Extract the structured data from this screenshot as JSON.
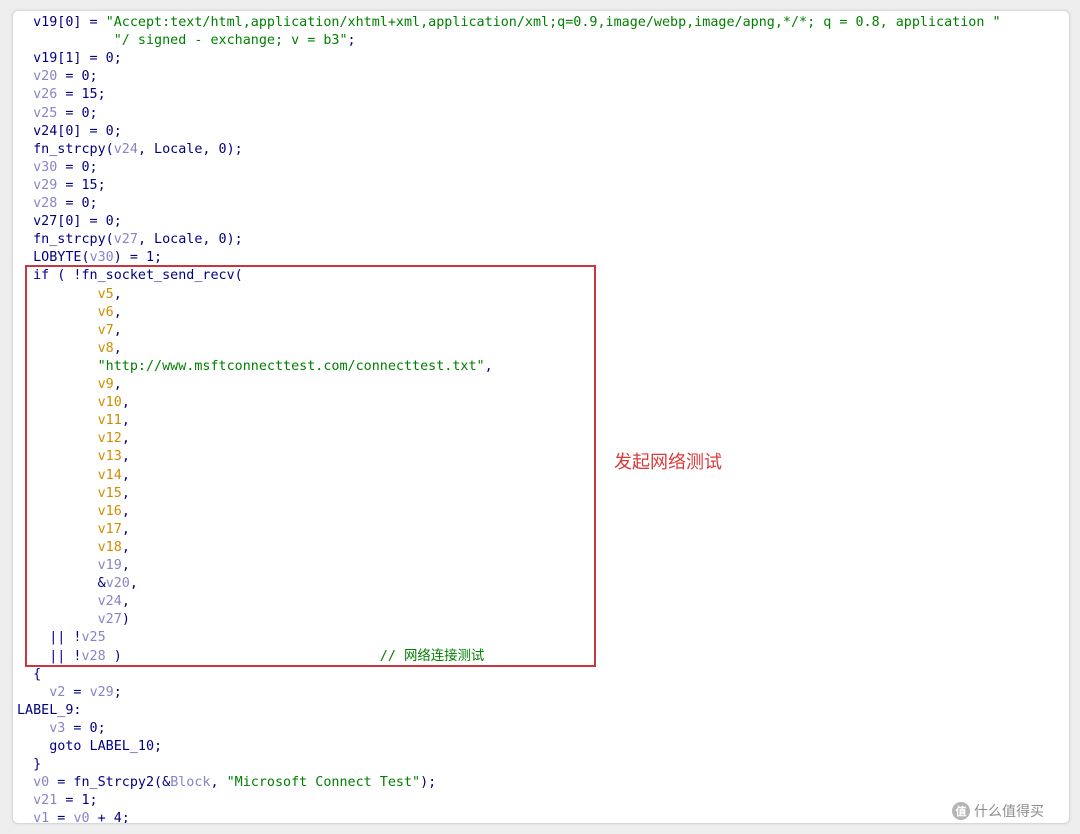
{
  "annotation": "发起网络测试",
  "watermark": {
    "icon": "值",
    "text": "什么值得买"
  },
  "code_lines": [
    {
      "indent": "  ",
      "segments": [
        {
          "t": "v19[0] = ",
          "c": "tok-kw"
        },
        {
          "t": "\"Accept:text/html,application/xhtml+xml,application/xml;q=0.9,image/webp,image/apng,*/*; q = 0.8, application \"",
          "c": "tok-str"
        }
      ]
    },
    {
      "indent": "            ",
      "segments": [
        {
          "t": "\"/ signed - exchange; v = b3\"",
          "c": "tok-str"
        },
        {
          "t": ";",
          "c": "tok-kw"
        }
      ]
    },
    {
      "indent": "  ",
      "segments": [
        {
          "t": "v19[1] = 0;",
          "c": "tok-kw"
        }
      ]
    },
    {
      "indent": "  ",
      "segments": [
        {
          "t": "v20",
          "c": "tok-var"
        },
        {
          "t": " = 0;",
          "c": "tok-kw"
        }
      ]
    },
    {
      "indent": "  ",
      "segments": [
        {
          "t": "v26",
          "c": "tok-var"
        },
        {
          "t": " = 15;",
          "c": "tok-kw"
        }
      ]
    },
    {
      "indent": "  ",
      "segments": [
        {
          "t": "v25",
          "c": "tok-var"
        },
        {
          "t": " = 0;",
          "c": "tok-kw"
        }
      ]
    },
    {
      "indent": "  ",
      "segments": [
        {
          "t": "v24[0] = 0;",
          "c": "tok-kw"
        }
      ]
    },
    {
      "indent": "  ",
      "segments": [
        {
          "t": "fn_strcpy(",
          "c": "tok-fn"
        },
        {
          "t": "v24",
          "c": "tok-var"
        },
        {
          "t": ", Locale, 0);",
          "c": "tok-kw"
        }
      ]
    },
    {
      "indent": "  ",
      "segments": [
        {
          "t": "v30",
          "c": "tok-var"
        },
        {
          "t": " = 0;",
          "c": "tok-kw"
        }
      ]
    },
    {
      "indent": "  ",
      "segments": [
        {
          "t": "v29",
          "c": "tok-var"
        },
        {
          "t": " = 15;",
          "c": "tok-kw"
        }
      ]
    },
    {
      "indent": "  ",
      "segments": [
        {
          "t": "v28",
          "c": "tok-var"
        },
        {
          "t": " = 0;",
          "c": "tok-kw"
        }
      ]
    },
    {
      "indent": "  ",
      "segments": [
        {
          "t": "v27[0] = 0;",
          "c": "tok-kw"
        }
      ]
    },
    {
      "indent": "  ",
      "segments": [
        {
          "t": "fn_strcpy(",
          "c": "tok-fn"
        },
        {
          "t": "v27",
          "c": "tok-var"
        },
        {
          "t": ", Locale, 0);",
          "c": "tok-kw"
        }
      ]
    },
    {
      "indent": "  ",
      "segments": [
        {
          "t": "LOBYTE(",
          "c": "tok-kw"
        },
        {
          "t": "v30",
          "c": "tok-var"
        },
        {
          "t": ") = 1;",
          "c": "tok-kw"
        }
      ]
    },
    {
      "indent": "  ",
      "segments": [
        {
          "t": "if ( !fn_socket_send_recv(",
          "c": "tok-kw"
        }
      ]
    },
    {
      "indent": "          ",
      "segments": [
        {
          "t": "v5",
          "c": "tok-arg"
        },
        {
          "t": ",",
          "c": "tok-kw"
        }
      ]
    },
    {
      "indent": "          ",
      "segments": [
        {
          "t": "v6",
          "c": "tok-arg"
        },
        {
          "t": ",",
          "c": "tok-kw"
        }
      ]
    },
    {
      "indent": "          ",
      "segments": [
        {
          "t": "v7",
          "c": "tok-arg"
        },
        {
          "t": ",",
          "c": "tok-kw"
        }
      ]
    },
    {
      "indent": "          ",
      "segments": [
        {
          "t": "v8",
          "c": "tok-arg"
        },
        {
          "t": ",",
          "c": "tok-kw"
        }
      ]
    },
    {
      "indent": "          ",
      "segments": [
        {
          "t": "\"http://www.msftconnecttest.com/connecttest.txt\"",
          "c": "tok-str"
        },
        {
          "t": ",",
          "c": "tok-kw"
        }
      ]
    },
    {
      "indent": "          ",
      "segments": [
        {
          "t": "v9",
          "c": "tok-arg"
        },
        {
          "t": ",",
          "c": "tok-kw"
        }
      ]
    },
    {
      "indent": "          ",
      "segments": [
        {
          "t": "v10",
          "c": "tok-arg"
        },
        {
          "t": ",",
          "c": "tok-kw"
        }
      ]
    },
    {
      "indent": "          ",
      "segments": [
        {
          "t": "v11",
          "c": "tok-arg"
        },
        {
          "t": ",",
          "c": "tok-kw"
        }
      ]
    },
    {
      "indent": "          ",
      "segments": [
        {
          "t": "v12",
          "c": "tok-arg"
        },
        {
          "t": ",",
          "c": "tok-kw"
        }
      ]
    },
    {
      "indent": "          ",
      "segments": [
        {
          "t": "v13",
          "c": "tok-arg"
        },
        {
          "t": ",",
          "c": "tok-kw"
        }
      ]
    },
    {
      "indent": "          ",
      "segments": [
        {
          "t": "v14",
          "c": "tok-arg"
        },
        {
          "t": ",",
          "c": "tok-kw"
        }
      ]
    },
    {
      "indent": "          ",
      "segments": [
        {
          "t": "v15",
          "c": "tok-arg"
        },
        {
          "t": ",",
          "c": "tok-kw"
        }
      ]
    },
    {
      "indent": "          ",
      "segments": [
        {
          "t": "v16",
          "c": "tok-arg"
        },
        {
          "t": ",",
          "c": "tok-kw"
        }
      ]
    },
    {
      "indent": "          ",
      "segments": [
        {
          "t": "v17",
          "c": "tok-arg"
        },
        {
          "t": ",",
          "c": "tok-kw"
        }
      ]
    },
    {
      "indent": "          ",
      "segments": [
        {
          "t": "v18",
          "c": "tok-arg"
        },
        {
          "t": ",",
          "c": "tok-kw"
        }
      ]
    },
    {
      "indent": "          ",
      "segments": [
        {
          "t": "v19",
          "c": "tok-var"
        },
        {
          "t": ",",
          "c": "tok-kw"
        }
      ]
    },
    {
      "indent": "          ",
      "segments": [
        {
          "t": "&",
          "c": "tok-kw"
        },
        {
          "t": "v20",
          "c": "tok-var"
        },
        {
          "t": ",",
          "c": "tok-kw"
        }
      ]
    },
    {
      "indent": "          ",
      "segments": [
        {
          "t": "v24",
          "c": "tok-var"
        },
        {
          "t": ",",
          "c": "tok-kw"
        }
      ]
    },
    {
      "indent": "          ",
      "segments": [
        {
          "t": "v27",
          "c": "tok-var"
        },
        {
          "t": ")",
          "c": "tok-kw"
        }
      ]
    },
    {
      "indent": "    ",
      "segments": [
        {
          "t": "|| !",
          "c": "tok-kw"
        },
        {
          "t": "v25",
          "c": "tok-var"
        }
      ]
    },
    {
      "indent": "    ",
      "segments": [
        {
          "t": "|| !",
          "c": "tok-kw"
        },
        {
          "t": "v28",
          "c": "tok-var"
        },
        {
          "t": " )                                ",
          "c": "tok-kw"
        },
        {
          "t": "// 网络连接测试",
          "c": "tok-comment"
        }
      ]
    },
    {
      "indent": "  ",
      "segments": [
        {
          "t": "{",
          "c": "tok-kw"
        }
      ]
    },
    {
      "indent": "    ",
      "segments": [
        {
          "t": "v2",
          "c": "tok-var"
        },
        {
          "t": " = ",
          "c": "tok-kw"
        },
        {
          "t": "v29",
          "c": "tok-var"
        },
        {
          "t": ";",
          "c": "tok-kw"
        }
      ]
    },
    {
      "indent": "",
      "segments": [
        {
          "t": "LABEL_9:",
          "c": "tok-kw"
        }
      ]
    },
    {
      "indent": "    ",
      "segments": [
        {
          "t": "v3",
          "c": "tok-var"
        },
        {
          "t": " = 0;",
          "c": "tok-kw"
        }
      ]
    },
    {
      "indent": "    ",
      "segments": [
        {
          "t": "goto LABEL_10;",
          "c": "tok-kw"
        }
      ]
    },
    {
      "indent": "  ",
      "segments": [
        {
          "t": "}",
          "c": "tok-kw"
        }
      ]
    },
    {
      "indent": "  ",
      "segments": [
        {
          "t": "v0",
          "c": "tok-var"
        },
        {
          "t": " = fn_Strcpy2(&",
          "c": "tok-kw"
        },
        {
          "t": "Block",
          "c": "tok-var"
        },
        {
          "t": ", ",
          "c": "tok-kw"
        },
        {
          "t": "\"Microsoft Connect Test\"",
          "c": "tok-str"
        },
        {
          "t": ");",
          "c": "tok-kw"
        }
      ]
    },
    {
      "indent": "  ",
      "segments": [
        {
          "t": "v21",
          "c": "tok-var"
        },
        {
          "t": " = 1;",
          "c": "tok-kw"
        }
      ]
    },
    {
      "indent": "  ",
      "segments": [
        {
          "t": "v1",
          "c": "tok-var"
        },
        {
          "t": " = ",
          "c": "tok-kw"
        },
        {
          "t": "v0",
          "c": "tok-var"
        },
        {
          "t": " + 4;",
          "c": "tok-kw"
        }
      ]
    }
  ]
}
